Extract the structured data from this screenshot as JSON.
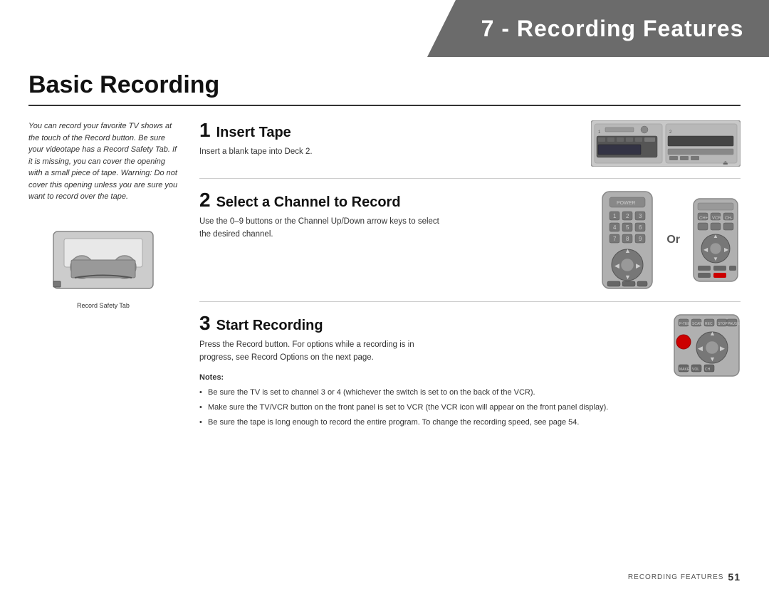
{
  "header": {
    "title": "7 - Recording Features"
  },
  "page": {
    "main_title": "Basic Recording"
  },
  "left_column": {
    "intro_text": "You can record your favorite TV shows at the touch of the Record button. Be sure your videotape has a Record Safety Tab. If it is missing, you can cover the opening with a small piece of tape. Warning: Do not cover this opening unless you are sure you want to record over the tape.",
    "cassette_label": "Record Safety Tab"
  },
  "steps": [
    {
      "number": "1",
      "title": "Insert Tape",
      "description": "Insert a blank tape into Deck 2."
    },
    {
      "number": "2",
      "title": "Select a Channel to Record",
      "description": "Use the 0–9 buttons or the Channel Up/Down arrow keys to select the desired channel."
    },
    {
      "number": "3",
      "title": "Start Recording",
      "description": "Press the Record button. For options while a recording is in progress, see Record Options on the next page."
    }
  ],
  "notes": {
    "title": "Notes:",
    "items": [
      "Be sure the TV is set to channel 3 or 4 (whichever the switch is set to on the back of the VCR).",
      "Make sure the TV/VCR button on the front panel is set to VCR (the VCR icon will appear on the front panel display).",
      "Be sure the tape is long enough to record the entire program. To change the recording speed, see page 54."
    ]
  },
  "footer": {
    "label": "RECORDING FEATURES",
    "page_number": "51"
  },
  "or_label": "Or"
}
